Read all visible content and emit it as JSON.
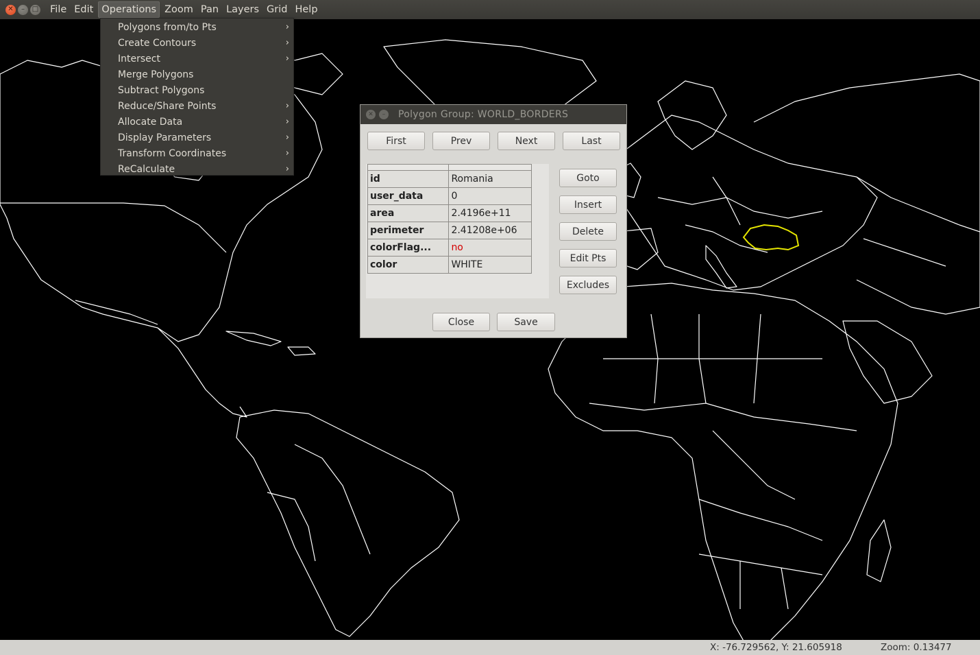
{
  "menubar": {
    "items": [
      "File",
      "Edit",
      "Operations",
      "Zoom",
      "Pan",
      "Layers",
      "Grid",
      "Help"
    ],
    "active": "Operations"
  },
  "operations_menu": {
    "items": [
      {
        "label": "Polygons from/to Pts",
        "submenu": true
      },
      {
        "label": "Create Contours",
        "submenu": true
      },
      {
        "label": "Intersect",
        "submenu": true
      },
      {
        "label": "Merge Polygons",
        "submenu": false
      },
      {
        "label": "Subtract Polygons",
        "submenu": false
      },
      {
        "label": "Reduce/Share Points",
        "submenu": true
      },
      {
        "label": "Allocate Data",
        "submenu": true
      },
      {
        "label": "Display Parameters",
        "submenu": true
      },
      {
        "label": "Transform Coordinates",
        "submenu": true
      },
      {
        "label": "ReCalculate",
        "submenu": true
      }
    ],
    "submenu_glyph": "›"
  },
  "dialog": {
    "title": "Polygon Group: WORLD_BORDERS",
    "nav": {
      "first": "First",
      "prev": "Prev",
      "next": "Next",
      "last": "Last"
    },
    "side": {
      "goto": "Goto",
      "insert": "Insert",
      "delete": "Delete",
      "edit_pts": "Edit Pts",
      "excludes": "Excludes"
    },
    "bottom": {
      "close": "Close",
      "save": "Save"
    },
    "attributes": [
      {
        "key": "id",
        "value": "Romania"
      },
      {
        "key": "user_data",
        "value": "0"
      },
      {
        "key": "area",
        "value": "2.4196e+11"
      },
      {
        "key": "perimeter",
        "value": "2.41208e+06"
      },
      {
        "key": "colorFlag...",
        "value": "no"
      },
      {
        "key": "color",
        "value": "WHITE"
      }
    ]
  },
  "status": {
    "coords": "X: -76.729562, Y: 21.605918",
    "zoom": "Zoom: 0.13477"
  },
  "colors": {
    "map_background": "#000000",
    "borders": "#ffffff",
    "highlight": "#e6e600"
  },
  "icons": {
    "window_close": "close-icon",
    "window_minimize": "minimize-icon",
    "window_maximize": "maximize-icon",
    "submenu": "chevron-right-icon"
  }
}
